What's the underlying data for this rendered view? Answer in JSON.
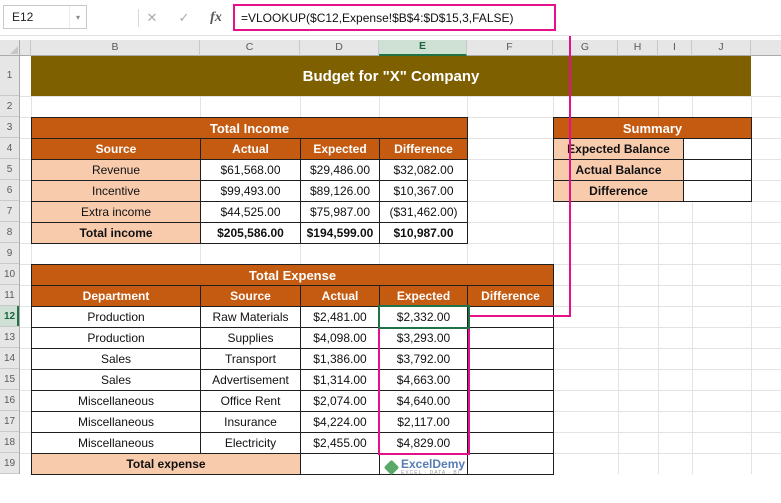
{
  "formula_bar": {
    "name_box": "E12",
    "dropdown_icon": "▾",
    "cancel_icon": "✕",
    "enter_icon": "✓",
    "fx_icon": "fx",
    "formula": "=VLOOKUP($C12,Expense!$B$4:$D$15,3,FALSE)"
  },
  "grid": {
    "column_letters": [
      "B",
      "C",
      "D",
      "E",
      "F",
      "G",
      "H",
      "I",
      "J"
    ],
    "row_numbers": [
      "1",
      "2",
      "3",
      "4",
      "5",
      "6",
      "7",
      "8",
      "9",
      "10",
      "11",
      "12",
      "13",
      "14",
      "15",
      "16",
      "17",
      "18",
      "19"
    ],
    "selected_cell": "E12"
  },
  "banner": {
    "title": "Budget for \"X\" Company"
  },
  "income": {
    "title": "Total Income",
    "headers": [
      "Source",
      "Actual",
      "Expected",
      "Difference"
    ],
    "rows": [
      [
        "Revenue",
        "$61,568.00",
        "$29,486.00",
        "$32,082.00"
      ],
      [
        "Incentive",
        "$99,493.00",
        "$89,126.00",
        "$10,367.00"
      ],
      [
        "Extra income",
        "$44,525.00",
        "$75,987.00",
        "($31,462.00)"
      ]
    ],
    "total_row": [
      "Total income",
      "$205,586.00",
      "$194,599.00",
      "$10,987.00"
    ]
  },
  "summary": {
    "title": "Summary",
    "labels": [
      "Expected Balance",
      "Actual Balance",
      "Difference"
    ]
  },
  "expense": {
    "title": "Total Expense",
    "headers": [
      "Department",
      "Source",
      "Actual",
      "Expected",
      "Difference"
    ],
    "rows": [
      [
        "Production",
        "Raw Materials",
        "$2,481.00",
        "$2,332.00"
      ],
      [
        "Production",
        "Supplies",
        "$4,098.00",
        "$3,293.00"
      ],
      [
        "Sales",
        "Transport",
        "$1,386.00",
        "$3,792.00"
      ],
      [
        "Sales",
        "Advertisement",
        "$1,314.00",
        "$4,663.00"
      ],
      [
        "Miscellaneous",
        "Office Rent",
        "$2,074.00",
        "$4,640.00"
      ],
      [
        "Miscellaneous",
        "Insurance",
        "$4,224.00",
        "$2,117.00"
      ],
      [
        "Miscellaneous",
        "Electricity",
        "$2,455.00",
        "$4,829.00"
      ]
    ],
    "total_label": "Total expense"
  },
  "watermark": {
    "name": "ExcelDemy",
    "tagline": "EXCEL · DATA · BI"
  },
  "colors": {
    "banner": "#7F6000",
    "table_header": "#C55A11",
    "row_shade": "#F8CBAD",
    "annotation": "#E6118A",
    "selection": "#217346"
  }
}
